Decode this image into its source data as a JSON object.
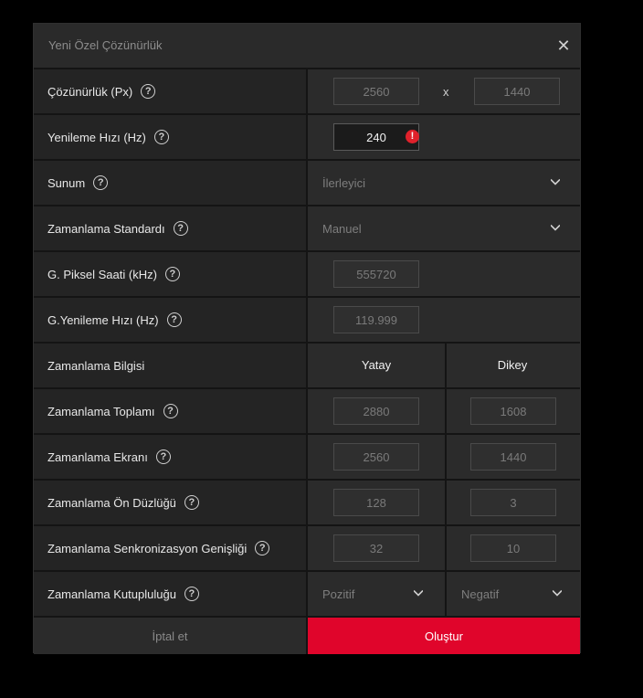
{
  "dialog": {
    "title": "Yeni Özel Çözünürlük",
    "close_glyph": "✕"
  },
  "rows": {
    "resolution": {
      "label": "Çözünürlük (Px)",
      "width": "2560",
      "separator": "x",
      "height": "1440"
    },
    "refresh": {
      "label": "Yenileme Hızı (Hz)",
      "value": "240",
      "warning": "!"
    },
    "presentation": {
      "label": "Sunum",
      "value": "İlerleyici"
    },
    "timing_standard": {
      "label": "Zamanlama Standardı",
      "value": "Manuel"
    },
    "pixel_clock": {
      "label": "G. Piksel Saati (kHz)",
      "value": "555720"
    },
    "g_refresh": {
      "label": "G.Yenileme Hızı (Hz)",
      "value": "119.999"
    },
    "timing_info": {
      "label": "Zamanlama Bilgisi",
      "horizontal": "Yatay",
      "vertical": "Dikey"
    },
    "timing_total": {
      "label": "Zamanlama Toplamı",
      "h": "2880",
      "v": "1608"
    },
    "timing_display": {
      "label": "Zamanlama Ekranı",
      "h": "2560",
      "v": "1440"
    },
    "timing_front_porch": {
      "label": "Zamanlama Ön Düzlüğü",
      "h": "128",
      "v": "3"
    },
    "timing_sync_width": {
      "label": "Zamanlama Senkronizasyon Genişliği",
      "h": "32",
      "v": "10"
    },
    "timing_polarity": {
      "label": "Zamanlama Kutupluluğu",
      "h": "Pozitif",
      "v": "Negatif"
    }
  },
  "help_glyph": "?",
  "footer": {
    "cancel": "İptal et",
    "create": "Oluştur"
  },
  "colors": {
    "accent": "#e0052b",
    "warning": "#e0212b"
  }
}
